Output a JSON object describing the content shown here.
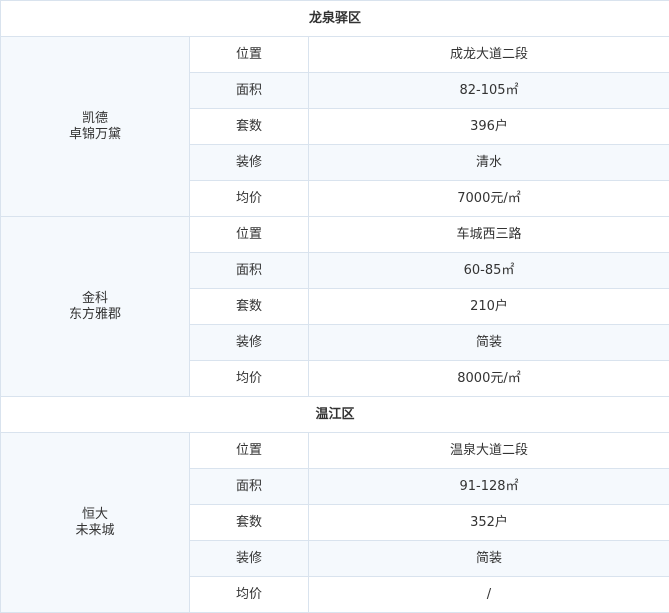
{
  "groups": [
    {
      "district": "龙泉驿区",
      "projects": [
        {
          "name_lines": [
            "凯德",
            "卓锦万黛"
          ],
          "rows": [
            {
              "key": "位置",
              "value": "成龙大道二段"
            },
            {
              "key": "面积",
              "value": "82-105㎡"
            },
            {
              "key": "套数",
              "value": "396户"
            },
            {
              "key": "装修",
              "value": "清水"
            },
            {
              "key": "均价",
              "value": "7000元/㎡"
            }
          ]
        },
        {
          "name_lines": [
            "金科",
            "东方雅郡"
          ],
          "rows": [
            {
              "key": "位置",
              "value": "车城西三路"
            },
            {
              "key": "面积",
              "value": "60-85㎡"
            },
            {
              "key": "套数",
              "value": "210户"
            },
            {
              "key": "装修",
              "value": "简装"
            },
            {
              "key": "均价",
              "value": "8000元/㎡"
            }
          ]
        }
      ]
    },
    {
      "district": "温江区",
      "projects": [
        {
          "name_lines": [
            "恒大",
            "未来城"
          ],
          "rows": [
            {
              "key": "位置",
              "value": "温泉大道二段"
            },
            {
              "key": "面积",
              "value": "91-128㎡"
            },
            {
              "key": "套数",
              "value": "352户"
            },
            {
              "key": "装修",
              "value": "简装"
            },
            {
              "key": "均价",
              "value": "/"
            }
          ]
        }
      ]
    }
  ]
}
